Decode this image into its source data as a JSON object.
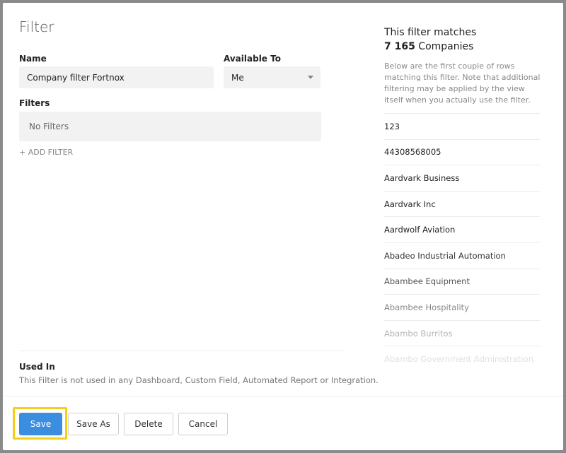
{
  "dialog": {
    "title": "Filter"
  },
  "form": {
    "name_label": "Name",
    "name_value": "Company filter Fortnox",
    "available_label": "Available To",
    "available_value": "Me",
    "filters_label": "Filters",
    "filters_empty": "No Filters",
    "add_filter": "+ ADD FILTER"
  },
  "used_in": {
    "label": "Used In",
    "text": "This Filter is not used in any Dashboard, Custom Field, Automated Report or Integration."
  },
  "matches": {
    "title": "This filter matches",
    "count": "7 165",
    "entity": "Companies",
    "description": "Below are the first couple of rows matching this filter. Note that additional filtering may be applied by the view itself when you actually use the filter.",
    "rows": [
      "123",
      "44308568005",
      "Aardvark Business",
      "Aardvark Inc",
      "Aardwolf Aviation",
      "Abadeo Industrial Automation",
      "Abambee Equipment",
      "Abambee Hospitality",
      "Abambo Burritos",
      "Abambo Government Administration"
    ]
  },
  "buttons": {
    "save": "Save",
    "save_as": "Save As",
    "delete": "Delete",
    "cancel": "Cancel"
  },
  "colors": {
    "primary": "#3b8de0",
    "highlight": "#f4cf1a"
  }
}
